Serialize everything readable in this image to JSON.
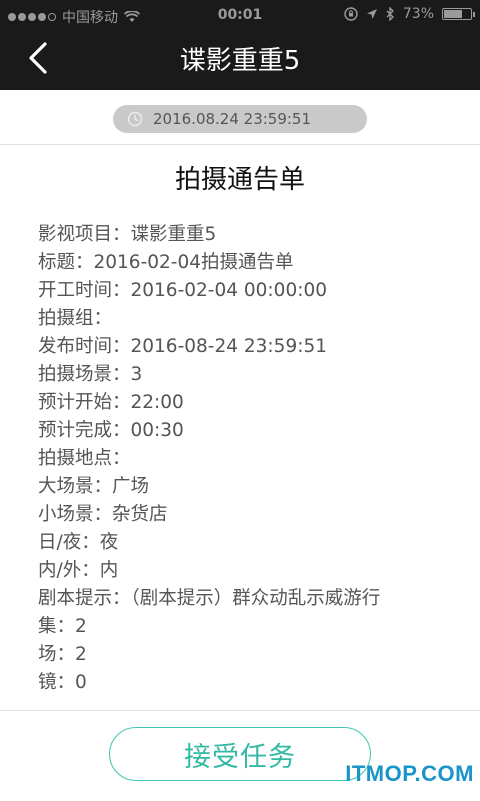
{
  "status_bar": {
    "carrier": "中国移动",
    "time": "00:01",
    "battery": "73%",
    "battery_level": 0.73
  },
  "nav": {
    "title": "谍影重重5"
  },
  "timestamp": "2016.08.24 23:59:51",
  "document": {
    "title": "拍摄通告单",
    "fields": [
      "影视项目：谍影重重5",
      "标题：2016-02-04拍摄通告单",
      "开工时间：2016-02-04 00:00:00",
      "拍摄组：",
      "发布时间：2016-08-24 23:59:51",
      "拍摄场景：3",
      "预计开始：22:00",
      "预计完成：00:30",
      "拍摄地点：",
      "大场景：广场",
      "小场景：杂货店",
      "日/夜：夜",
      "内/外：内",
      "剧本提示：（剧本提示）群众动乱示威游行",
      "集：2",
      "场：2",
      "镜：0"
    ]
  },
  "actions": {
    "accept_label": "接受任务"
  },
  "watermark": "ITMOP.COM",
  "colors": {
    "accent": "#3cc6b0",
    "header_bg": "#1a1a1a"
  }
}
